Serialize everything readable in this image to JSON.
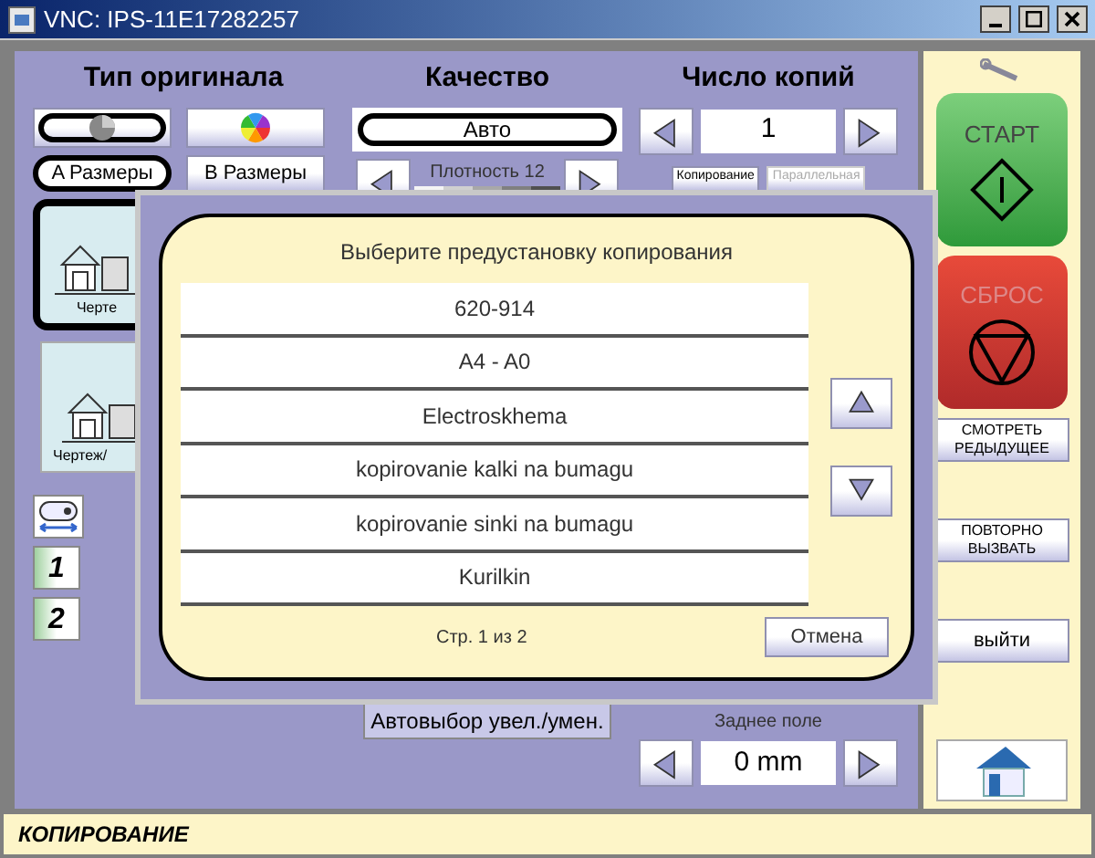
{
  "window": {
    "title": "VNC: IPS-11E17282257"
  },
  "original_type": {
    "heading": "Тип оригинала",
    "mode_buttons": [
      {
        "kind": "grayscale",
        "selected": true
      },
      {
        "kind": "color",
        "selected": false
      }
    ],
    "size_buttons": [
      {
        "label": "A Размеры",
        "selected": true
      },
      {
        "label": "B Размеры",
        "selected": false
      }
    ],
    "tiles": [
      {
        "label": "Черте",
        "selected": true
      },
      {
        "label": "Чертеж/",
        "selected": false
      }
    ],
    "trays": [
      {
        "label": "1"
      },
      {
        "label": "2"
      }
    ]
  },
  "quality": {
    "heading": "Качество",
    "value": "Авто",
    "density_label": "Плотность 12",
    "auto_button": "Автовыбор увел./умен."
  },
  "copies": {
    "heading": "Число копий",
    "value": "1",
    "buttons": [
      {
        "label": "Копирование",
        "disabled": false
      },
      {
        "label": "Параллельная",
        "disabled": true
      }
    ],
    "margin_label": "Заднее поле",
    "margin_value": "0 mm"
  },
  "side": {
    "start": "СТАРТ",
    "reset": "СБРОС",
    "buttons": [
      {
        "label": "СМОТРЕТЬ\nРЕДЫДУЩЕЕ"
      },
      {
        "label": "ПОВТОРНО\nВЫЗВАТЬ"
      },
      {
        "label": "выйти"
      }
    ]
  },
  "dialog": {
    "title": "Выберите предустановку копирования",
    "items": [
      {
        "label": "620-914"
      },
      {
        "label": "A4 - A0"
      },
      {
        "label": "Electroskhema"
      },
      {
        "label": "kopirovanie kalki na bumagu"
      },
      {
        "label": "kopirovanie sinki na bumagu"
      },
      {
        "label": "Kurilkin"
      }
    ],
    "page": "Стр. 1 из 2",
    "cancel": "Отмена"
  },
  "status_bar": "КОПИРОВАНИЕ"
}
